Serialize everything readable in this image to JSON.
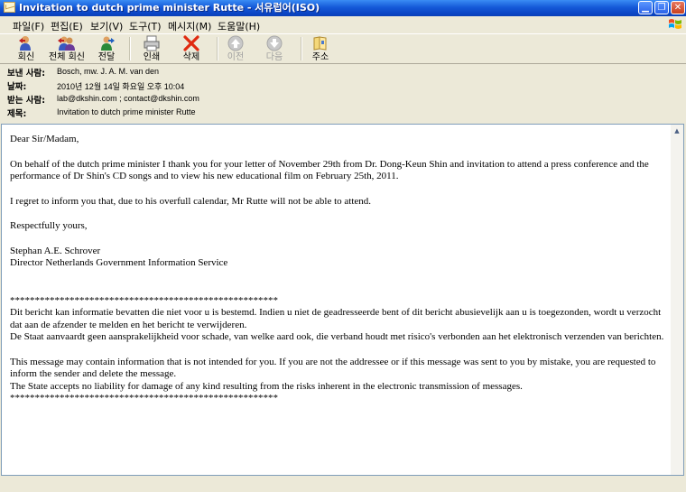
{
  "window": {
    "title": "Invitation to dutch prime minister Rutte  - 서유럽어(ISO)"
  },
  "menu": {
    "items": [
      "파일(F)",
      "편집(E)",
      "보기(V)",
      "도구(T)",
      "메시지(M)",
      "도움말(H)"
    ]
  },
  "toolbar": {
    "reply": "회신",
    "reply_all": "전체 회신",
    "forward": "전달",
    "print": "인쇄",
    "delete": "삭제",
    "previous": "이전",
    "next": "다음",
    "addresses": "주소"
  },
  "header": {
    "from_label": "보낸 사람:",
    "from_value": "Bosch, mw. J. A. M. van den",
    "date_label": "날짜:",
    "date_value": "2010년 12월 14일 화요일 오후 10:04",
    "to_label": "받는 사람:",
    "to_value": "lab@dkshin.com ; contact@dkshin.com",
    "subject_label": "제목:",
    "subject_value": "Invitation to dutch prime minister Rutte"
  },
  "body": {
    "greeting": "Dear Sir/Madam,",
    "para1": "On behalf of the dutch prime minister I thank you for your letter of November 29th from Dr. Dong-Keun Shin and invitation to attend a press conference and the performance of Dr Shin's CD songs and to view his new educational film on February 25th, 2011.",
    "para2": "I regret to inform you that, due to his overfull calendar, Mr Rutte will not be able to attend.",
    "closing": "Respectfully yours,",
    "sig_name": "Stephan A.E. Schrover",
    "sig_title": "Director Netherlands Government Information Service",
    "stars": "******************************************************",
    "disclaimer_nl_1": "Dit bericht kan informatie bevatten die niet voor u is bestemd. Indien u niet de geadresseerde bent of dit bericht abusievelijk aan u is toegezonden, wordt u verzocht dat aan de afzender te melden en het bericht te verwijderen.",
    "disclaimer_nl_2": "De Staat aanvaardt geen aansprakelijkheid voor schade, van welke aard ook, die verband houdt met risico's verbonden aan het elektronisch verzenden van berichten.",
    "disclaimer_en_1": "This message may contain information that is not intended for you. If you are not the addressee or if this message was sent to you by mistake, you are requested to inform the sender and delete the message.",
    "disclaimer_en_2": "The State accepts no liability for damage of any kind resulting from the risks inherent in the electronic transmission of messages.",
    "stars_end": "******************************************************"
  },
  "icons": {
    "app": "mail-envelope-icon",
    "reply": "reply-icon",
    "reply_all": "reply-all-icon",
    "forward": "forward-icon",
    "print": "printer-icon",
    "delete": "delete-x-icon",
    "previous": "up-arrow-icon",
    "next": "down-arrow-icon",
    "addresses": "address-book-icon"
  },
  "colors": {
    "titlebar": "#0b46c6",
    "delete_red": "#e02a10",
    "border_blue": "#7f9db9"
  }
}
